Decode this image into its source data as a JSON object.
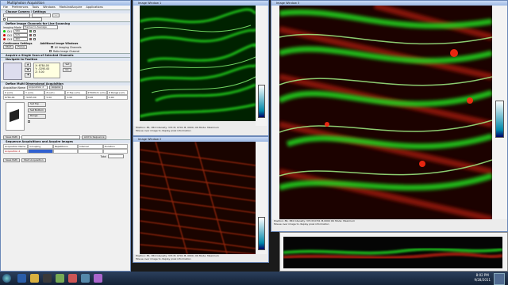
{
  "panel": {
    "title": "Multiphoton Acquisition",
    "menu": [
      "File",
      "Preferences",
      "Tools",
      "Windows",
      "MarkAndAcquire",
      "Applications"
    ],
    "sections": {
      "camera": "Choose Camera / Settings",
      "channels": "Define Image Channels for Live Scanning",
      "continuous": "Continuous Settings",
      "acquire_scan": "Acquire a Single Scan of Selected Channels",
      "navigate": "Navigate to Position",
      "multidim": "Define Multi Dimensional Acquisition",
      "sequence": "Sequence Acquisitions and Acquire Images",
      "additional": "Additional Image Windows"
    },
    "imaging_mode_label": "Imaging Mode",
    "imaging_mode_value": "Frames to Average",
    "channels": [
      {
        "name": "Ch1",
        "color": "#00cc00",
        "value": "580"
      },
      {
        "name": "Ch2",
        "color": "#cc0000",
        "value": "515"
      },
      {
        "name": "Ch3",
        "color": "#cc0000",
        "value": "460"
      }
    ],
    "buttons": {
      "live": "Start",
      "focus": "Focus",
      "acquire": "Acquire",
      "save": "Save Path",
      "sequence": "Add to Sequence",
      "start_seq": "Start Acquisition"
    },
    "additional_items": [
      "Ch1",
      "Ch2",
      "All Imaging Channels",
      "Ratio Image Channel"
    ],
    "position": {
      "x": "X: 6784.00",
      "y": "Y: -5295.00",
      "z": "Z: 5.00"
    },
    "table_headers": [
      "X (um)",
      "Y (um)",
      "Z (um)",
      "Z Top (um)",
      "Z Bottom (um)",
      "Z Range (um)"
    ],
    "table_values": [
      "6784.00",
      "-5295.00",
      "5.00",
      "0.00",
      "0.00",
      "0.00"
    ],
    "acq_name_label": "Acquisition Name",
    "acq_name_value": "Acquisition 2",
    "seq_headers": [
      "Acquisition Name",
      "Grouping",
      "Repetitions",
      "Interval",
      "Duration"
    ],
    "total_label": "Total"
  },
  "windows": {
    "w1_title": "Image Window 1",
    "w2_title": "Image Window 2",
    "w3_title": "Image Window 3",
    "w1_status": "Position: 85, 384  Intensity: 374 M, 0701 M, 0000, OK  Mode: Maximum",
    "w1_hint": "Mouse over image to display pixel information",
    "w2_status": "Position: 85, 384  Intensity: 374 M, 0701 M, 0000, OK  Mode: Maximum",
    "w2_hint": "Mouse over image to display pixel information",
    "w3_status": "Position: 86, 384  Intensity: 374 M,0701 M,0000 OK  Mode: Maximum",
    "w3_hint": "Mouse over image to display pixel information"
  },
  "taskbar": {
    "time": "8:02 PM",
    "date": "9/28/2011"
  },
  "colors": {
    "green": "#22d11e",
    "red": "#d0200f",
    "accent": "#9db9e4"
  }
}
